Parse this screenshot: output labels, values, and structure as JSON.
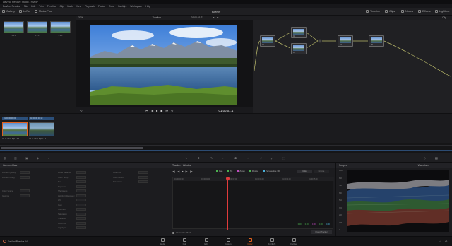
{
  "title_bar": {
    "text": "DaVinci Resolve Studio - RMNP"
  },
  "menu": [
    "DaVinci Resolve",
    "File",
    "Edit",
    "Trim",
    "Timeline",
    "Clip",
    "Mark",
    "View",
    "Playback",
    "Fusion",
    "Color",
    "Fairlight",
    "Workspace",
    "Help"
  ],
  "toolbar": {
    "gallery_label": "Gallery",
    "luts_label": "LUTs",
    "media_pool_label": "Media Pool",
    "project_name": "RMNP",
    "timeline_btn": "Timeline",
    "clips_btn": "Clips",
    "nodes_btn": "Nodes",
    "effects_btn": "Effects",
    "lightbox_btn": "Lightbox"
  },
  "gallery": {
    "stills": [
      "1.1.1",
      "1.2.1",
      "1.3.1"
    ]
  },
  "viewer": {
    "zoom": "33%",
    "timeline_name": "Timeline 1",
    "source_timecode": "01:00:01:21",
    "timecode": "01:00:01:17"
  },
  "nodes": {
    "mode": "Clip",
    "items": [
      "01",
      "02",
      "03",
      "04",
      "05",
      "06"
    ]
  },
  "clips": [
    {
      "index": "01",
      "tc": "01:00:00:00",
      "label": "V1 H.264 High L4.1"
    },
    {
      "index": "02",
      "tc": "01:00:04:13",
      "label": "V1 H.264 High L4.1"
    }
  ],
  "color_wheels": {
    "title": "Camera Raw",
    "params_left": [
      "Decode Quality",
      "Decode Using",
      "",
      "",
      "Color Space",
      "Gamma",
      "",
      "",
      ""
    ],
    "params_mid": [
      "White Balance",
      "Color Temp",
      "Tint",
      "Exposure",
      "Sharpness",
      "Highlight Recovery",
      "Lift",
      "Gain",
      "Contrast",
      "Saturation",
      "Shadows",
      "Midtones",
      "Highlights"
    ],
    "params_right": [
      "Midtones",
      "Color Boost",
      "Saturation"
    ]
  },
  "tracker": {
    "title": "Tracker - Window",
    "toggles": [
      "Pan",
      "Tilt",
      "Zoom",
      "Rotate",
      "Perspective 3D"
    ],
    "mode_options": [
      "Clip",
      "Frame"
    ],
    "ruler": [
      "01:00:00:00",
      "01:00:01:00",
      "01:00:02:00",
      "01:00:03:00",
      "01:00:04:00",
      "01:00:05:00"
    ],
    "values": [
      "0.00",
      "0.00",
      "0.00",
      "0.00",
      "0.00"
    ],
    "interactive_mode_label": "Interactive Mode",
    "cloud_tracker_label": "Cloud Tracker"
  },
  "scopes": {
    "title": "Scopes",
    "mode": "Waveform",
    "scale": [
      "1023",
      "896",
      "768",
      "640",
      "512",
      "384",
      "256",
      "128",
      "0"
    ]
  },
  "footer": {
    "app_label": "DaVinci Resolve 14"
  },
  "pages": [
    "Media",
    "Cut",
    "Edit",
    "Fusion",
    "Color",
    "Fairlight",
    "Deliver"
  ],
  "active_page": "Color",
  "accent_color": "#e0601e"
}
